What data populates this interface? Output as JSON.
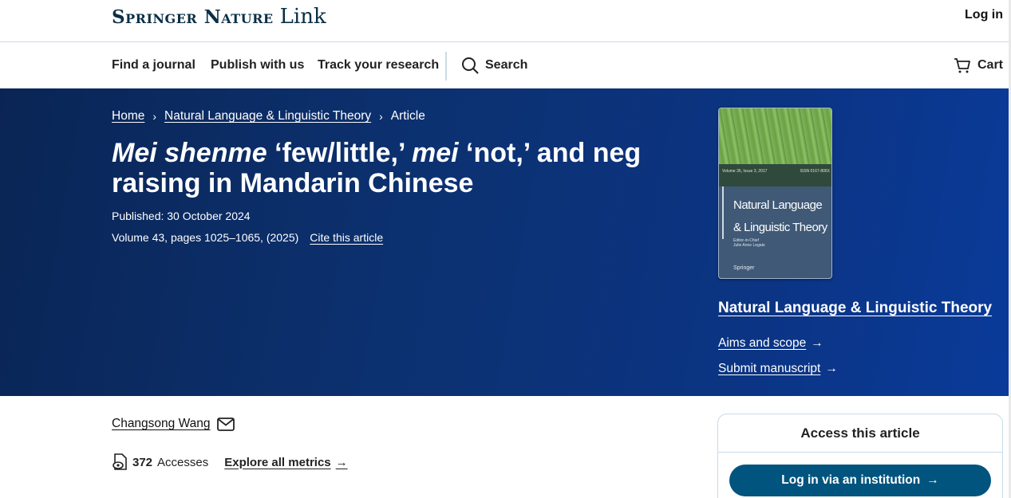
{
  "header": {
    "logo_main": "Springer Nature",
    "logo_sub": "Link",
    "login_label": "Log in"
  },
  "nav": {
    "items": [
      "Find a journal",
      "Publish with us",
      "Track your research"
    ],
    "search_label": "Search",
    "cart_label": "Cart"
  },
  "breadcrumb": {
    "home": "Home",
    "journal": "Natural Language & Linguistic Theory",
    "current": "Article"
  },
  "article": {
    "title_part1_italic": "Mei shenme",
    "title_part2": " ‘few/little,’ ",
    "title_part3_italic": "mei",
    "title_part4": " ‘not,’ and neg raising in Mandarin Chinese",
    "published": "Published: 30 October 2024",
    "volume": "Volume 43, pages 1025–1065, (2025)",
    "cite_label": "Cite this article",
    "author": "Changsong Wang",
    "accesses_count": "372",
    "accesses_label": "Accesses",
    "explore_metrics": "Explore all metrics"
  },
  "journal": {
    "cover_volume": "Volume 35, Issue 3, 2017",
    "cover_issn": "ISSN 0167-806X",
    "cover_title_line1": "Natural Language",
    "cover_title_line2": "& Linguistic Theory",
    "cover_editor_label": "Editor-in-Chief",
    "cover_editor_name": "Julie Anne Legate",
    "cover_publisher": "Springer",
    "name": "Natural Language & Linguistic Theory",
    "aims_label": "Aims and scope",
    "submit_label": "Submit manuscript"
  },
  "access": {
    "title": "Access this article",
    "institution_button": "Log in via an institution"
  },
  "colors": {
    "hero_start": "#0a2555",
    "hero_end": "#0a3b9a",
    "button": "#01547e",
    "logo": "#0b2f45"
  }
}
